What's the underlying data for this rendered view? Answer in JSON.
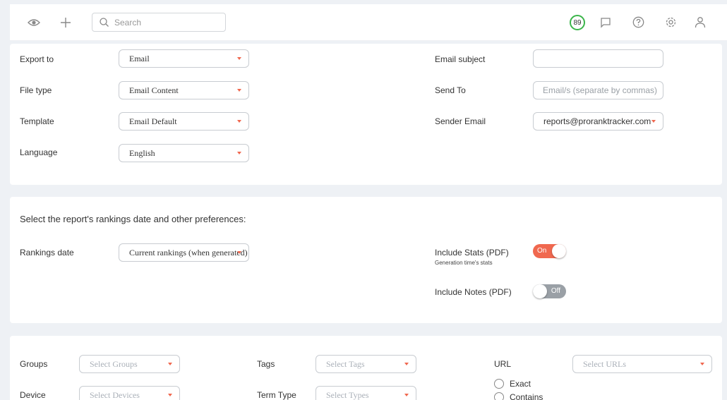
{
  "topbar": {
    "search_placeholder": "Search",
    "score": "89"
  },
  "export": {
    "export_to": {
      "label": "Export to",
      "value": "Email"
    },
    "file_type": {
      "label": "File type",
      "value": "Email Content"
    },
    "template": {
      "label": "Template",
      "value": "Email Default"
    },
    "language": {
      "label": "Language",
      "value": "English"
    },
    "email_subject": {
      "label": "Email subject",
      "value": ""
    },
    "send_to": {
      "label": "Send To",
      "placeholder": "Email/s (separate by commas)"
    },
    "sender_email": {
      "label": "Sender Email",
      "value": "reports@proranktracker.com"
    }
  },
  "prefs": {
    "heading": "Select the report's rankings date and other preferences:",
    "rankings_date": {
      "label": "Rankings date",
      "value": "Current rankings (when generated)"
    },
    "include_stats": {
      "label": "Include Stats (PDF)",
      "sublabel": "Generation time's stats",
      "state": "On"
    },
    "include_notes": {
      "label": "Include Notes (PDF)",
      "state": "Off"
    }
  },
  "filters": {
    "groups": {
      "label": "Groups",
      "placeholder": "Select Groups"
    },
    "tags": {
      "label": "Tags",
      "placeholder": "Select Tags"
    },
    "url": {
      "label": "URL",
      "placeholder": "Select URLs"
    },
    "device": {
      "label": "Device",
      "placeholder": "Select Devices"
    },
    "term_type": {
      "label": "Term Type",
      "placeholder": "Select Types"
    },
    "match": {
      "exact": "Exact",
      "contains": "Contains"
    }
  },
  "colors": {
    "accent": "#f0684f",
    "score_ring": "#3bb54a"
  }
}
